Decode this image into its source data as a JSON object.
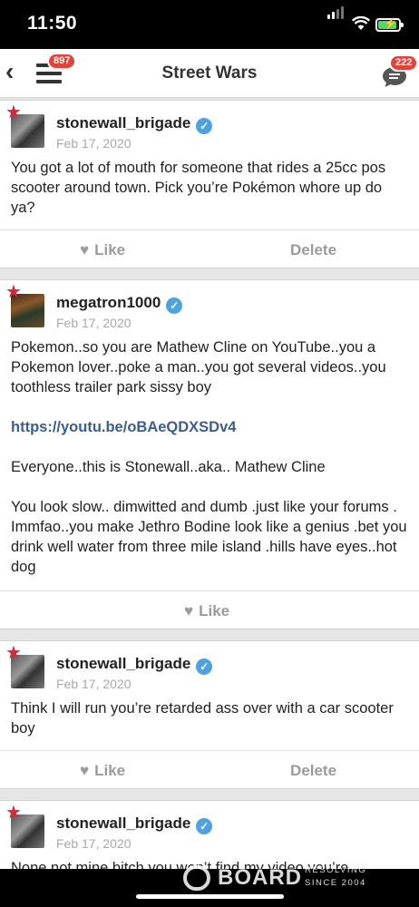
{
  "status_bar": {
    "time": "11:50"
  },
  "nav": {
    "title": "Street Wars",
    "menu_badge": "897",
    "chat_badge": "222"
  },
  "posts": [
    {
      "username": "stonewall_brigade",
      "date": "Feb 17, 2020",
      "paragraphs": [
        "You got a lot of mouth for someone that rides a 25cc pos scooter around town. Pick you’re Pokémon whore up do ya?"
      ],
      "like_label": "Like",
      "delete_label": "Delete"
    },
    {
      "username": "megatron1000",
      "date": "Feb 17, 2020",
      "paragraphs": [
        "Pokemon..so you are Mathew Cline on YouTube..you a Pokemon lover..poke a man..you got several videos..you toothless trailer park sissy boy",
        "Everyone..this is Stonewall..aka.. Mathew Cline",
        "You look slow.. dimwitted and dumb .just like your forums . Immfao..you make Jethro Bodine look like a genius .bet you drink well water from three mile island .hills have eyes..hot dog"
      ],
      "link": "https://youtu.be/oBAeQDXSDv4",
      "like_label": "Like"
    },
    {
      "username": "stonewall_brigade",
      "date": "Feb 17, 2020",
      "paragraphs": [
        "Think I will run you’re retarded ass over with a car scooter boy"
      ],
      "like_label": "Like",
      "delete_label": "Delete"
    },
    {
      "username": "stonewall_brigade",
      "date": "Feb 17, 2020",
      "paragraphs": [
        "None not mine bitch you won’t find my video you’re"
      ]
    }
  ],
  "watermark": {
    "brand": "BOARD",
    "line1": "RESOLVING",
    "line2": "SINCE 2004"
  },
  "colors": {
    "accent_red": "#e0443b",
    "verified_blue": "#4da3e0",
    "link_blue": "#3b5f8a"
  }
}
